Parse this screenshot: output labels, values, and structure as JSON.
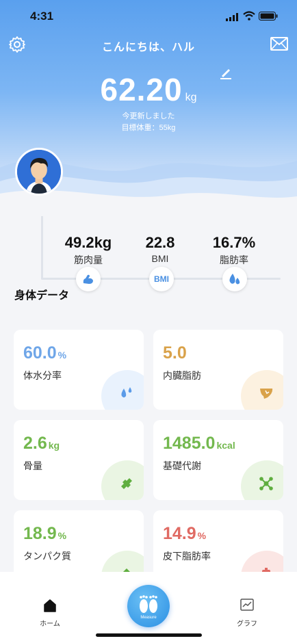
{
  "status": {
    "time": "4:31"
  },
  "header": {
    "greeting": "こんにちは、ハル",
    "weight": "62.20",
    "weight_unit": "kg",
    "updated": "今更新しました",
    "target": "目標体重：55kg"
  },
  "metrics": [
    {
      "value": "49.2kg",
      "label": "筋肉量",
      "icon": "muscle-icon"
    },
    {
      "value": "22.8",
      "label": "BMI",
      "icon": "bmi-icon"
    },
    {
      "value": "16.7%",
      "label": "脂肪率",
      "icon": "fat-drop-icon"
    }
  ],
  "bmi_badge": "BMI",
  "section_title": "身体データ",
  "cards": [
    {
      "value": "60.0",
      "unit": "%",
      "label": "体水分率",
      "color": "#6fa6e8",
      "blob": "#e9f2fd",
      "icon": "water-drop-icon"
    },
    {
      "value": "5.0",
      "unit": "",
      "label": "内臓脂肪",
      "color": "#d9a24a",
      "blob": "#fcf1e0",
      "icon": "liver-icon"
    },
    {
      "value": "2.6",
      "unit": "kg",
      "label": "骨量",
      "color": "#73b84e",
      "blob": "#eaf5e3",
      "icon": "bone-icon"
    },
    {
      "value": "1485.0",
      "unit": "kcal",
      "label": "基礎代謝",
      "color": "#73b84e",
      "blob": "#eaf5e3",
      "icon": "metabolism-icon"
    },
    {
      "value": "18.9",
      "unit": "%",
      "label": "タンパク質",
      "color": "#73b84e",
      "blob": "#eaf5e3",
      "icon": "protein-icon"
    },
    {
      "value": "14.9",
      "unit": "%",
      "label": "皮下脂肪率",
      "color": "#e06a63",
      "blob": "#fbe6e4",
      "icon": "subcutaneous-fat-icon"
    }
  ],
  "tabbar": {
    "home": "ホーム",
    "measure": "Measure",
    "graph": "グラフ"
  }
}
